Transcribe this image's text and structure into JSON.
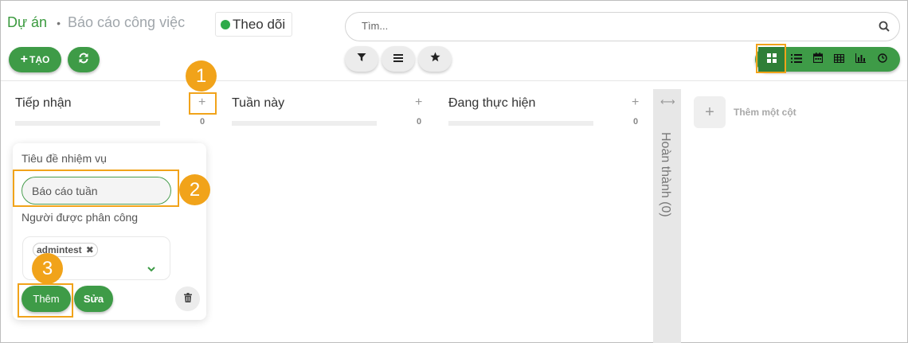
{
  "breadcrumb": {
    "project": "Dự án",
    "separator": "•",
    "page": "Báo cáo công việc"
  },
  "follow": {
    "label": "Theo dõi"
  },
  "search": {
    "placeholder": "Tìm..."
  },
  "toolbar": {
    "create_label": "TẠO"
  },
  "columns": [
    {
      "title": "Tiếp nhận",
      "count": "0"
    },
    {
      "title": "Tuần này",
      "count": "0"
    },
    {
      "title": "Đang thực hiện",
      "count": "0"
    }
  ],
  "folded_column": {
    "title": "Hoàn thành (0)"
  },
  "add_column": {
    "label": "Thêm một cột"
  },
  "quick_create": {
    "title_label": "Tiêu đề nhiệm vụ",
    "title_value": "Báo cáo tuần",
    "assignee_label": "Người được phân công",
    "assignee_tag": "admintest",
    "add_label": "Thêm",
    "edit_label": "Sửa"
  },
  "annotations": [
    "1",
    "2",
    "3"
  ],
  "colors": {
    "primary_green": "#3e9b47",
    "highlight_orange": "#f1a31a"
  }
}
